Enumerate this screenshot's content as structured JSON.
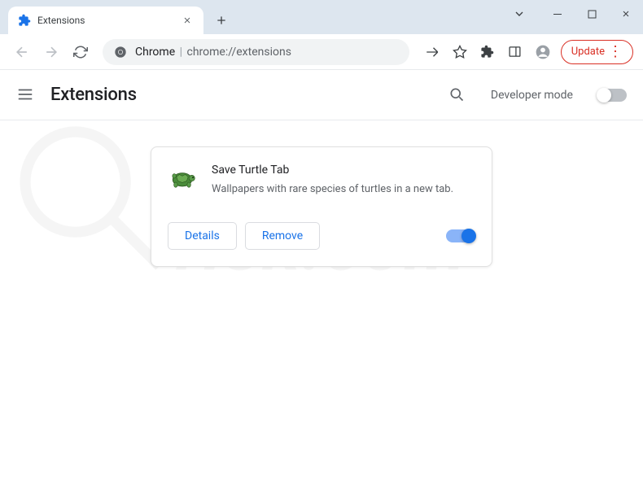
{
  "tab": {
    "title": "Extensions"
  },
  "omnibox": {
    "prefix": "Chrome",
    "url": "chrome://extensions"
  },
  "toolbar": {
    "update_label": "Update"
  },
  "header": {
    "title": "Extensions",
    "dev_mode_label": "Developer mode",
    "dev_mode_on": false
  },
  "extension": {
    "name": "Save Turtle Tab",
    "description": "Wallpapers with rare species of turtles in a new tab.",
    "enabled": true,
    "details_label": "Details",
    "remove_label": "Remove"
  },
  "watermark": "risk.com"
}
